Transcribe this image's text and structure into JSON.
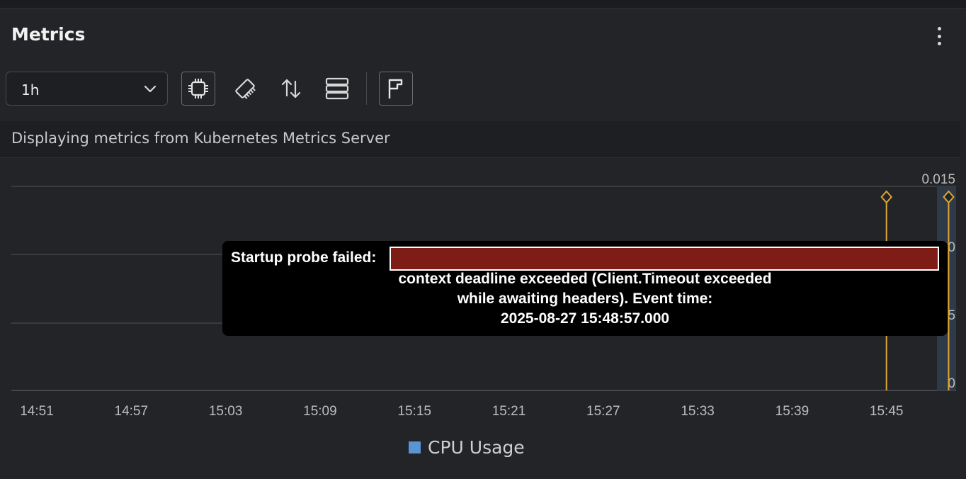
{
  "panel": {
    "title": "Metrics",
    "menu_icon": "more-vert-icon"
  },
  "toolbar": {
    "time_range": {
      "selected": "1h",
      "icon": "chevron-down-icon"
    },
    "buttons": [
      {
        "name": "cpu-metric-button",
        "icon": "cpu-icon",
        "selected": true
      },
      {
        "name": "memory-metric-button",
        "icon": "memory-icon",
        "selected": false
      },
      {
        "name": "network-metric-button",
        "icon": "arrows-up-down-icon",
        "selected": false
      },
      {
        "name": "filesystem-metric-button",
        "icon": "storage-icon",
        "selected": false
      },
      {
        "name": "events-toggle-button",
        "icon": "flag-icon",
        "selected": true
      }
    ]
  },
  "info_text": "Displaying metrics from Kubernetes Metrics Server",
  "tooltip": {
    "line1": "Startup probe failed:",
    "line2": "context deadline exceeded (Client.Timeout exceeded",
    "line3": "while awaiting headers). Event time:",
    "line4": "2025-08-27 15:48:57.000"
  },
  "legend": {
    "label": "CPU Usage",
    "color": "#5b93d3"
  },
  "chart_data": {
    "type": "area",
    "x_ticks": [
      "14:51",
      "14:57",
      "15:03",
      "15:09",
      "15:15",
      "15:21",
      "15:27",
      "15:33",
      "15:39",
      "15:45"
    ],
    "y_ticks": [
      "0.015",
      "0.010",
      "0.005",
      "0"
    ],
    "ylim": [
      0,
      0.015
    ],
    "grid": true,
    "series": [
      {
        "name": "CPU Usage",
        "color": "#5b93d3",
        "points": []
      }
    ],
    "events": [
      {
        "time": "15:45",
        "color": "#e0a534"
      },
      {
        "time": "15:48:57",
        "color": "#e0a534"
      }
    ]
  }
}
